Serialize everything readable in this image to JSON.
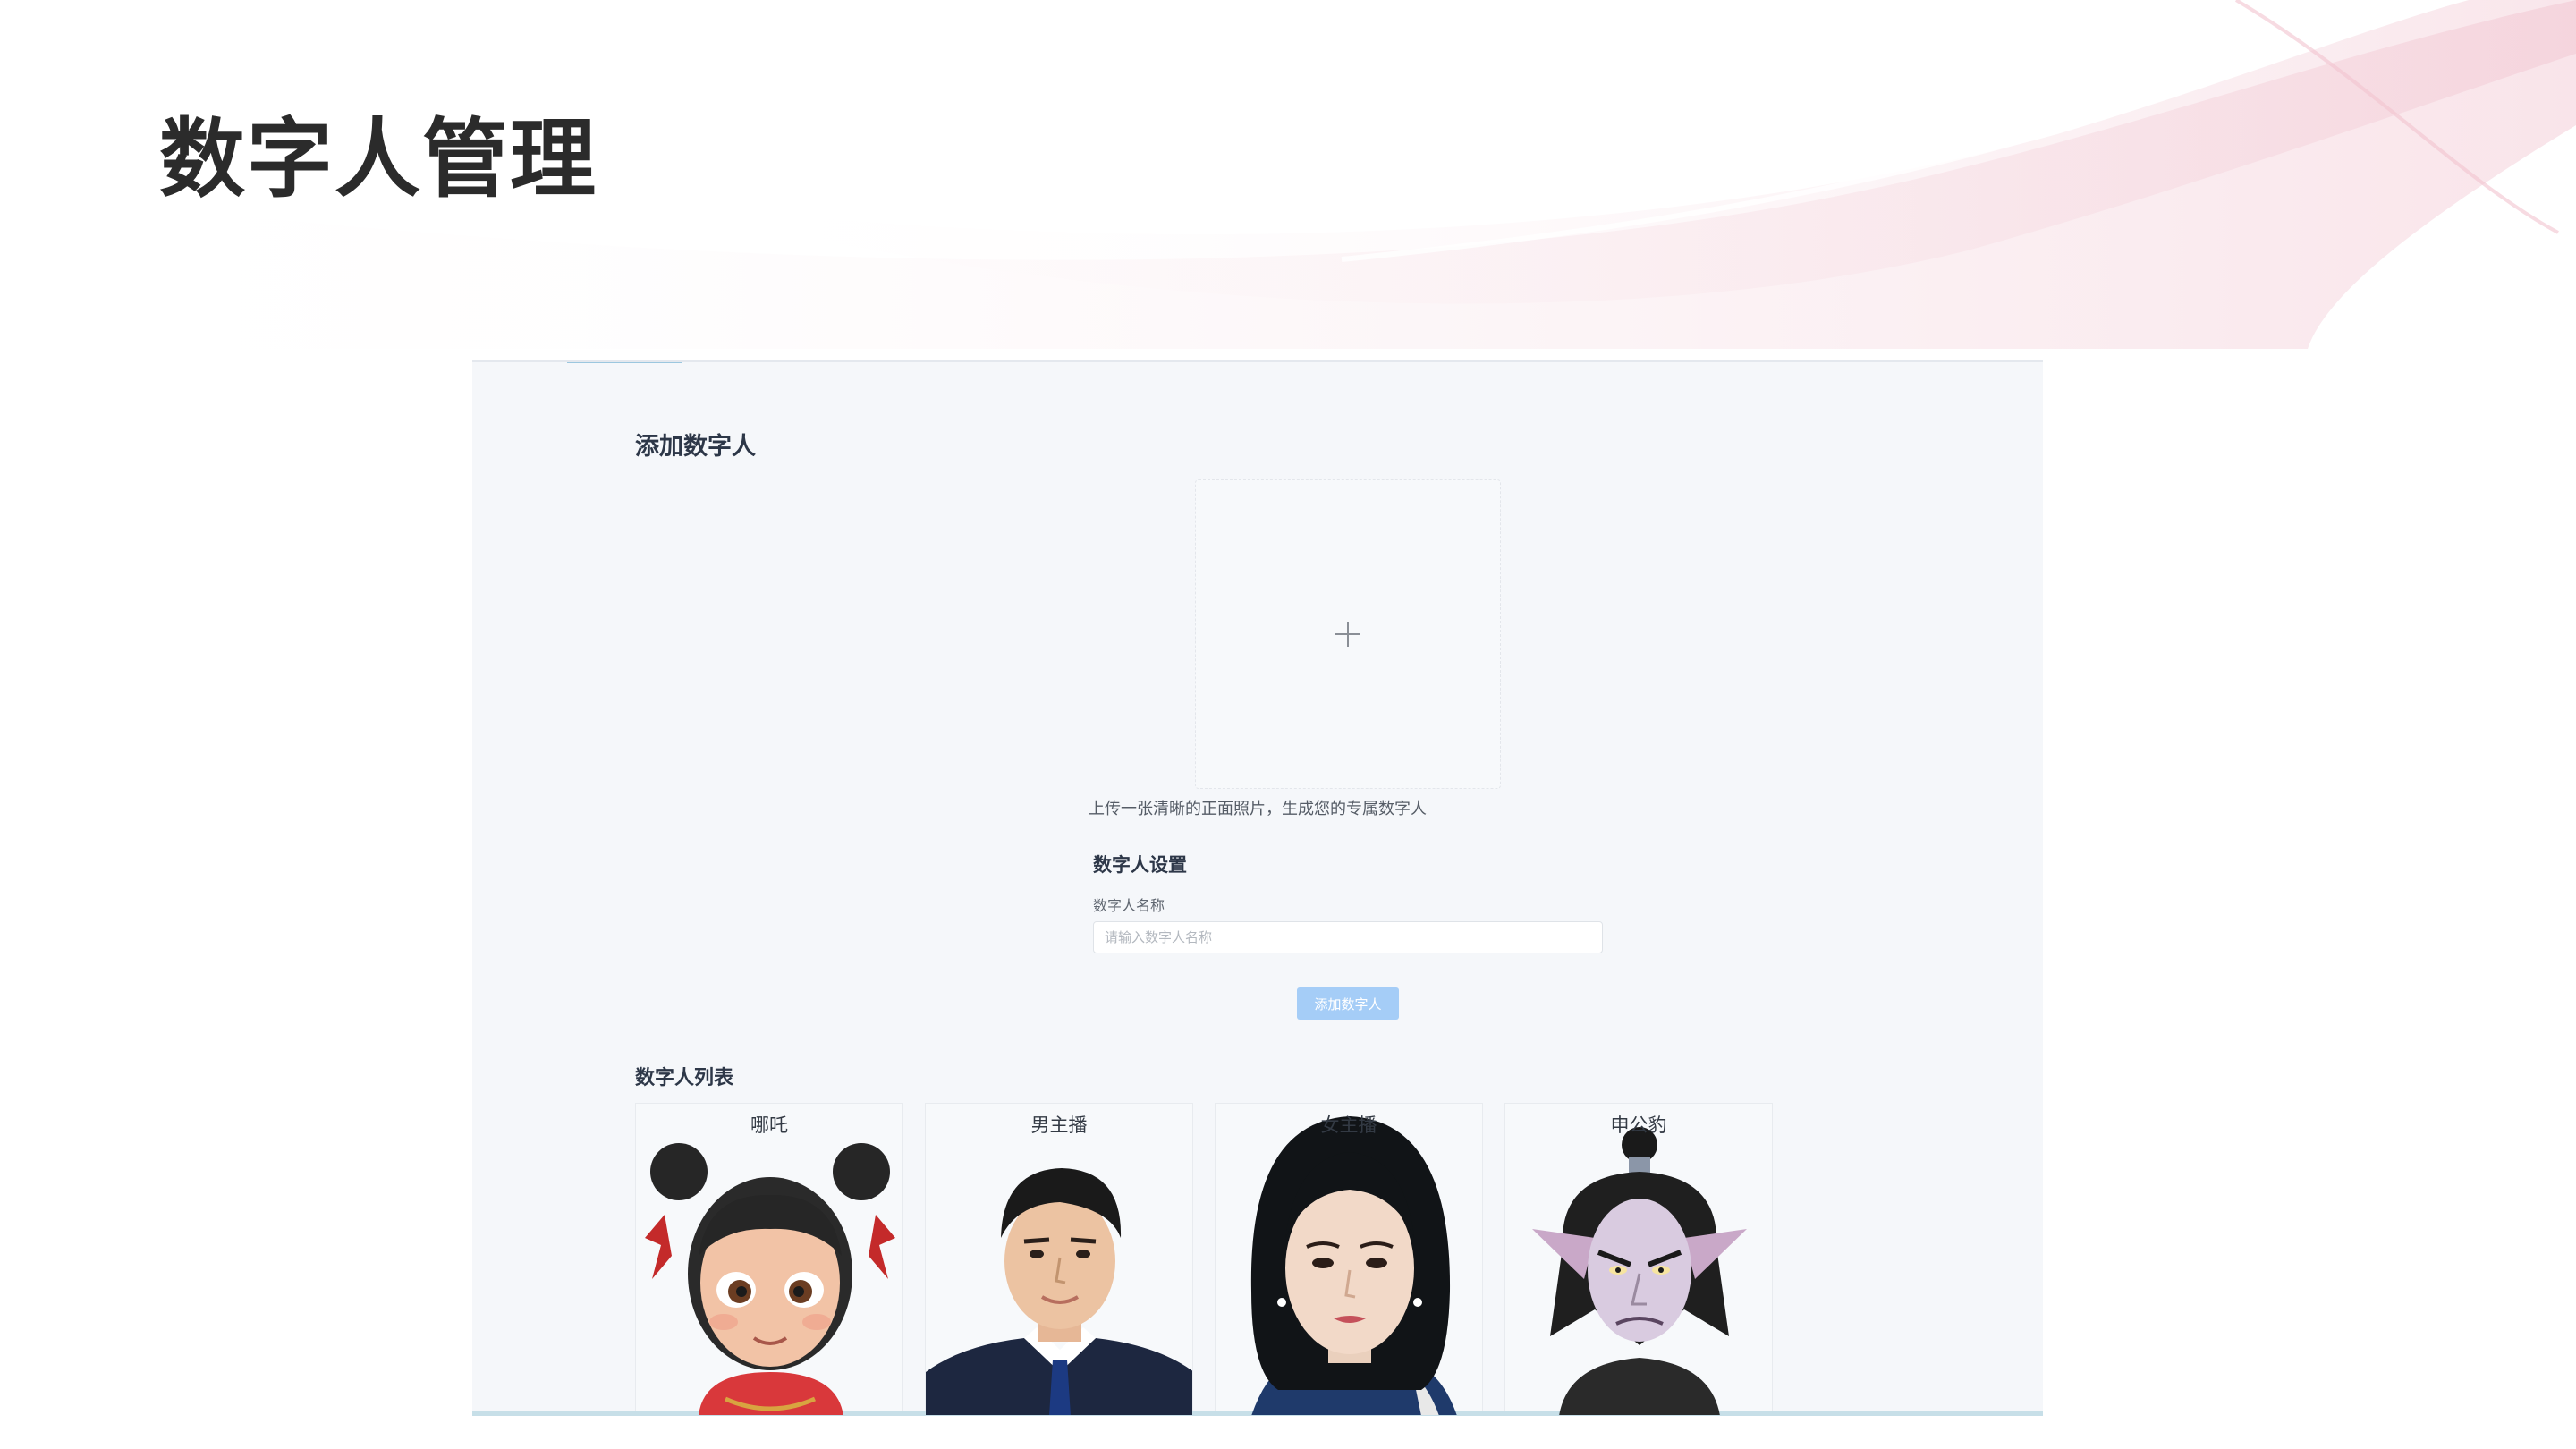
{
  "slide": {
    "title": "数字人管理"
  },
  "add_section": {
    "title": "添加数字人",
    "upload_hint": "上传一张清晰的正面照片，生成您的专属数字人",
    "upload_icon": "plus-icon"
  },
  "settings": {
    "title": "数字人设置",
    "name_label": "数字人名称",
    "name_value": "",
    "name_placeholder": "请输入数字人名称",
    "submit_label": "添加数字人"
  },
  "list": {
    "title": "数字人列表",
    "items": [
      {
        "name": "哪吒"
      },
      {
        "name": "男主播"
      },
      {
        "name": "女主播"
      },
      {
        "name": "申公豹"
      }
    ]
  },
  "colors": {
    "accent": "#a5cdf7",
    "panel_bg": "#f5f7fa",
    "title_text": "#2b2b2b",
    "swoosh": "#f3d3dc"
  }
}
